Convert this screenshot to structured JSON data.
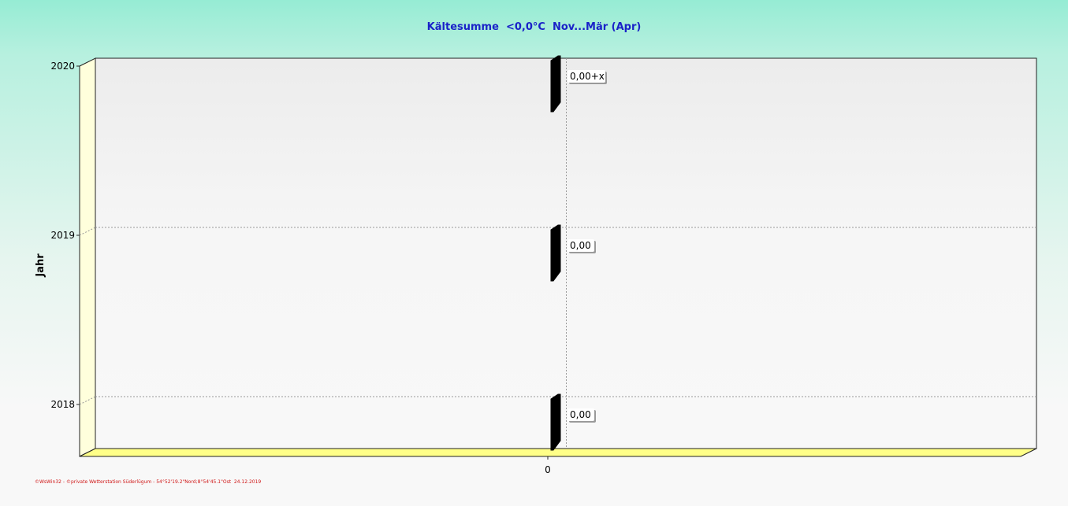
{
  "chart_data": {
    "type": "bar",
    "orientation": "horizontal",
    "title": "Kältesumme  <0,0°C  Nov...Mär (Apr)",
    "ylabel": "Jahr",
    "xlabel": "",
    "categories": [
      "2020",
      "2019",
      "2018"
    ],
    "values": [
      0,
      0,
      0
    ],
    "value_labels": [
      "0,00+x",
      "0,00",
      "0,00"
    ],
    "x_ticks": [
      "0"
    ],
    "xlim": [
      -1,
      1
    ],
    "grid": true,
    "legend": "none",
    "colors": {
      "bar": "#000000",
      "floor": "#ffff88",
      "side_wall": "#ffffdc",
      "title": "#1a22c8",
      "footer": "#d01818"
    }
  },
  "footer": "©WsWin32 - ©private Wetterstation Süderlügum - 54°52'19.2\"Nord;8°54'45.1\"Ost  24.12.2019"
}
